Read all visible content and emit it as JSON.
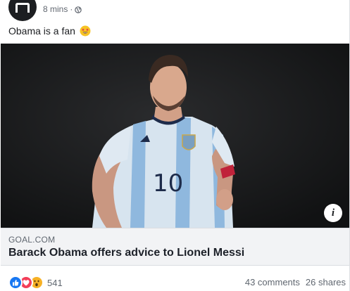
{
  "post": {
    "time": "8 mins",
    "separator": "·",
    "privacy_icon": "globe-icon",
    "text": "Obama is a fan",
    "emoji": "star-struck-emoji"
  },
  "media": {
    "info_label": "i"
  },
  "link": {
    "domain": "GOAL.COM",
    "title": "Barack Obama offers advice to Lionel Messi"
  },
  "footer": {
    "reactions": [
      "like",
      "love",
      "wow"
    ],
    "reaction_count": "541",
    "comments": "43 comments",
    "shares": "26 shares"
  },
  "colors": {
    "like": "#1877f2",
    "love": "#f33e58",
    "wow": "#f7b125",
    "link_bg": "#f2f3f5",
    "meta_text": "#616770"
  }
}
